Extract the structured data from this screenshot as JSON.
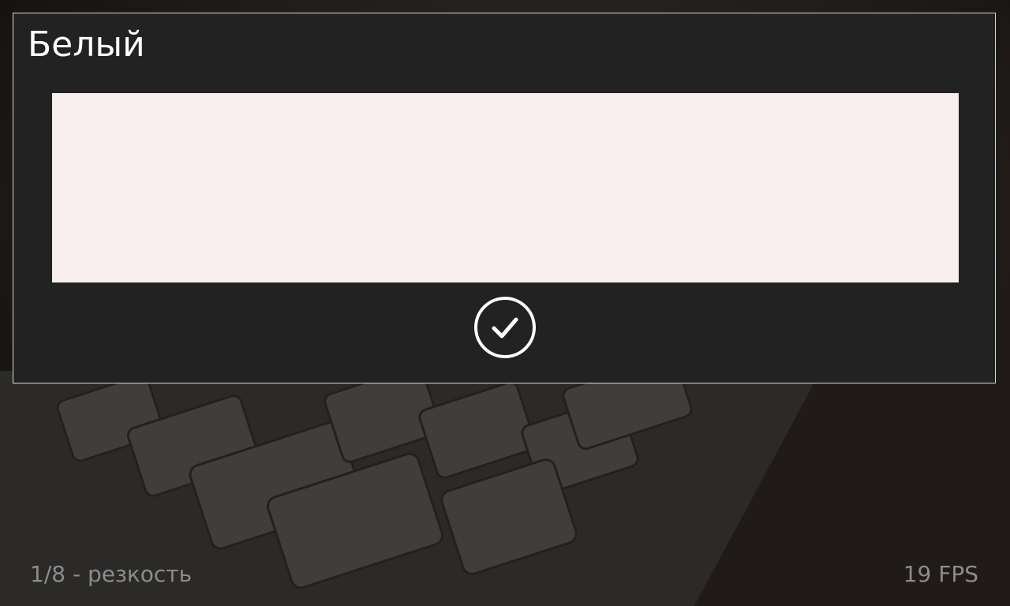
{
  "colors": {
    "dialog_bg": "#222222",
    "dialog_border": "#d8d8d8",
    "swatch": "#f8eeee",
    "title": "#ffffff",
    "status_text": "#8c8c8c",
    "confirm_icon": "#ffffff"
  },
  "dialog": {
    "title": "Белый",
    "confirm_icon": "check-circle-icon"
  },
  "status": {
    "progress": "1/8 - резкость",
    "fps": "19 FPS"
  }
}
